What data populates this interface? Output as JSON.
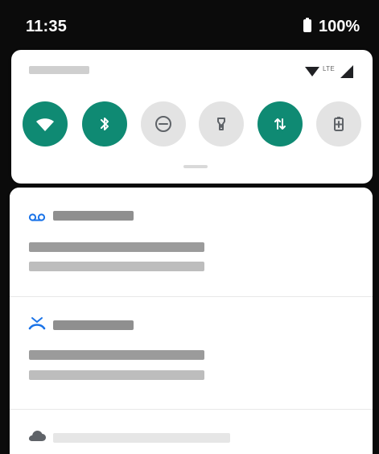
{
  "status_bar": {
    "time": "11:35",
    "battery_text": "100%"
  },
  "quick_settings": {
    "signal_label": "LTE",
    "tiles": [
      {
        "name": "wifi",
        "state": "on"
      },
      {
        "name": "bluetooth",
        "state": "on"
      },
      {
        "name": "do-not-disturb",
        "state": "off"
      },
      {
        "name": "flashlight",
        "state": "off"
      },
      {
        "name": "mobile-data",
        "state": "on"
      },
      {
        "name": "battery-saver",
        "state": "off"
      }
    ]
  },
  "notifications": [
    {
      "icon": "voicemail-icon"
    },
    {
      "icon": "missed-call-icon"
    },
    {
      "icon": "cloud-icon"
    }
  ],
  "colors": {
    "accent": "#0F8A73",
    "inactive_tile": "#E3E3E3",
    "status_bar": "#0B0B0B",
    "notification_blue": "#1A73E8"
  }
}
